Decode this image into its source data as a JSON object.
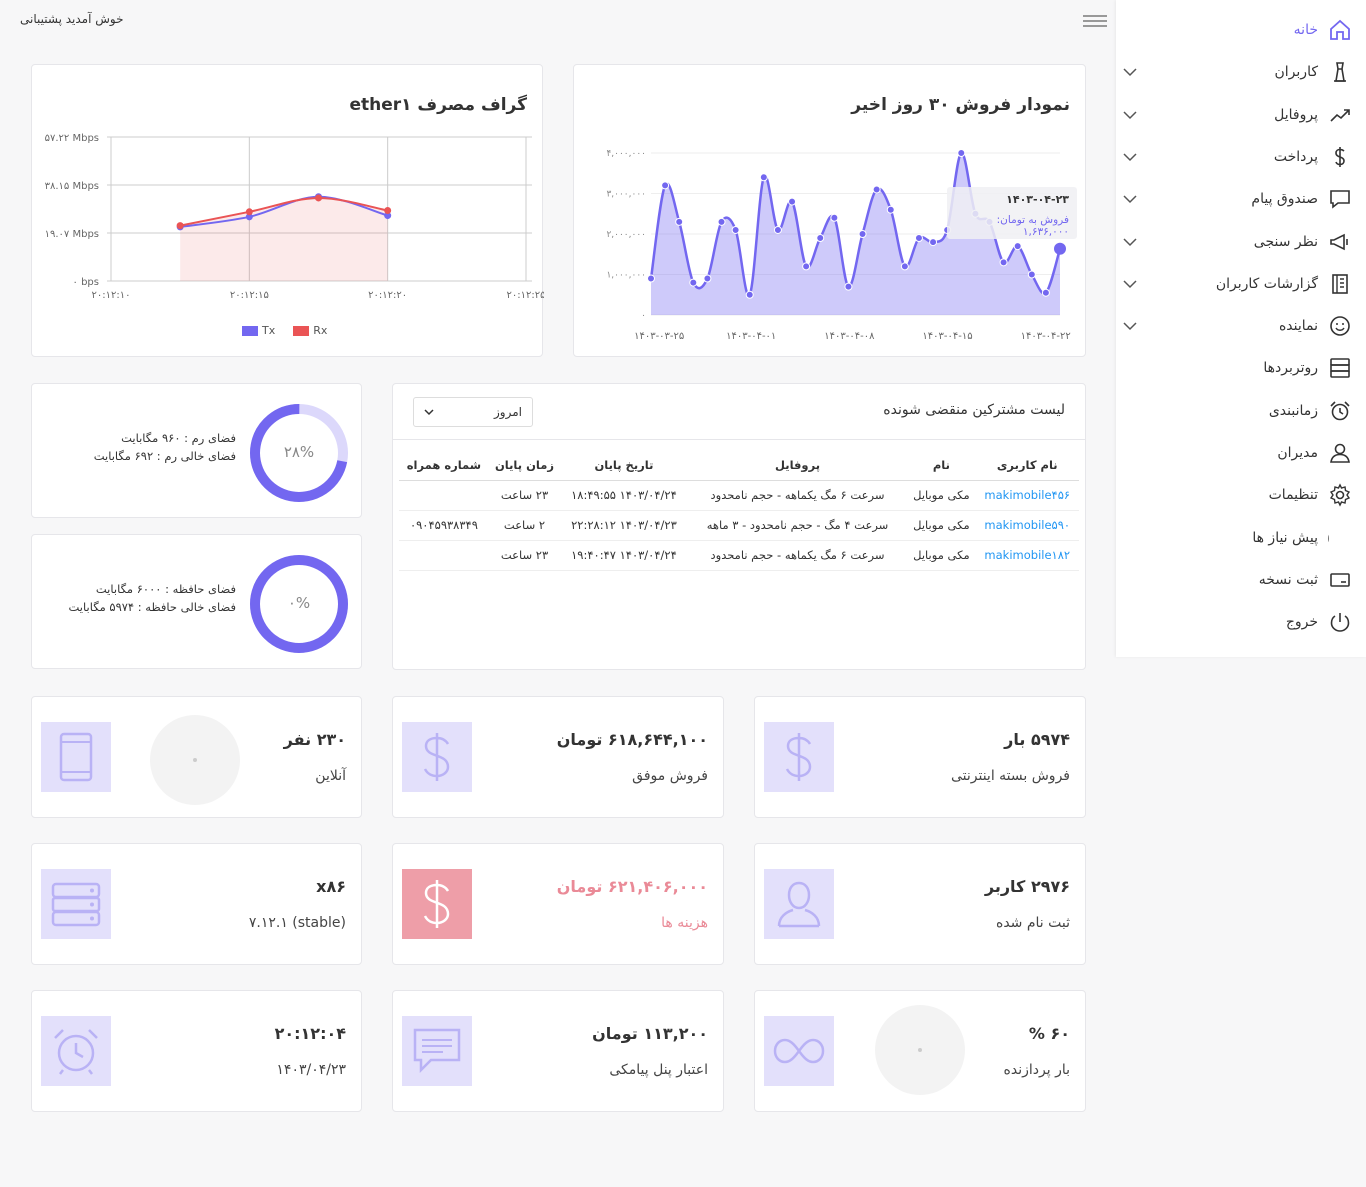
{
  "header": {
    "welcome": "خوش آمدید پشتیبانی"
  },
  "sidebar": {
    "items": [
      {
        "label": "خانه",
        "icon": "home-icon",
        "active": true
      },
      {
        "label": "کاربران",
        "icon": "user-tie-icon"
      },
      {
        "label": "پروفایل",
        "icon": "trend-icon"
      },
      {
        "label": "پرداخت",
        "icon": "dollar-icon"
      },
      {
        "label": "صندوق پیام",
        "icon": "message-icon"
      },
      {
        "label": "نظر سنجی",
        "icon": "megaphone-icon"
      },
      {
        "label": "گزارشات کاربران",
        "icon": "report-book-icon"
      },
      {
        "label": "نماینده",
        "icon": "smiley-icon"
      },
      {
        "label": "روتربردها",
        "icon": "server-icon"
      },
      {
        "label": "زمانبندی",
        "icon": "alarm-clock-icon"
      },
      {
        "label": "مدیران",
        "icon": "admin-user-icon"
      },
      {
        "label": "تنظیمات",
        "icon": "gear-icon"
      },
      {
        "label": "پیش نیاز ها",
        "icon": "quote-icon"
      },
      {
        "label": "ثبت نسخه",
        "icon": "card-icon"
      },
      {
        "label": "خروج",
        "icon": "power-icon"
      }
    ]
  },
  "traffic": {
    "title": "گراف مصرف ether۱",
    "legend": [
      "Tx",
      "Rx"
    ]
  },
  "sales": {
    "title": "نمودار فروش ۳۰ روز اخیر",
    "tooltip_date": "۱۴۰۳-۰۴-۲۳",
    "tooltip_value": "فروش به تومان: ۱,۶۳۶,۰۰۰"
  },
  "chart_data": [
    {
      "type": "line",
      "title": "گراف مصرف ether۱",
      "x": [
        "۲۰:۱۲:۱۰",
        "۲۰:۱۲:۱۵",
        "۲۰:۱۲:۲۰",
        "۲۰:۱۲:۲۵"
      ],
      "y_ticks": [
        "۰ bps",
        "۱۹.۰۷ Mbps",
        "۳۸.۱۵ Mbps",
        "۵۷.۲۲ Mbps"
      ],
      "ylim": [
        0,
        57.22
      ],
      "yunit": "Mbps",
      "series": [
        {
          "name": "Tx",
          "color": "#7367f0",
          "x_seconds": [
            12.5,
            15,
            17.5,
            20
          ],
          "values": [
            21.5,
            25.5,
            33.5,
            26.0
          ]
        },
        {
          "name": "Rx",
          "color": "#ea5455",
          "x_seconds": [
            12.5,
            15,
            17.5,
            20
          ],
          "values": [
            22.0,
            27.5,
            33.0,
            28.0
          ]
        }
      ],
      "legend": "bottom",
      "grid": true
    },
    {
      "type": "area",
      "title": "نمودار فروش ۳۰ روز اخیر",
      "x_ticks": [
        "۱۴۰۳-۰۳-۲۵",
        "۱۴۰۳-۰۴-۰۱",
        "۱۴۰۳-۰۴-۰۸",
        "۱۴۰۳-۰۴-۱۵",
        "۱۴۰۳-۰۴-۲۲"
      ],
      "y_ticks": [
        "۰",
        "۱,۰۰۰,۰۰۰",
        "۲,۰۰۰,۰۰۰",
        "۳,۰۰۰,۰۰۰",
        "۴,۰۰۰,۰۰۰"
      ],
      "ylim": [
        0,
        4000000
      ],
      "color": "#7367f0",
      "values": [
        900000,
        3200000,
        2300000,
        800000,
        900000,
        2300000,
        2100000,
        500000,
        3400000,
        2100000,
        2800000,
        1200000,
        1900000,
        2400000,
        700000,
        2000000,
        3100000,
        2600000,
        1200000,
        1900000,
        1800000,
        2100000,
        4000000,
        2500000,
        2300000,
        1300000,
        1700000,
        1000000,
        550000,
        1636000
      ],
      "grid": false
    }
  ],
  "resources": {
    "ram": {
      "percent_text": "۲۸%",
      "percent": 28,
      "line1": "فضای رم : ۹۶۰ مگابایت",
      "line2": "فضای خالی رم : ۶۹۲ مگابایت"
    },
    "storage": {
      "percent_text": "۰%",
      "percent": 0,
      "line1": "فضای حافظه : ۶۰۰۰ مگابایت",
      "line2": "فضای خالی حافظه : ۵۹۷۴ مگابایت"
    }
  },
  "expiring": {
    "title": "لیست مشترکین منقضی شونده",
    "filter": "امروز",
    "columns": [
      "نام کاربری",
      "نام",
      "پروفایل",
      "تاریخ پایان",
      "زمان پایان",
      "شماره همراه"
    ],
    "rows": [
      [
        "makimobile۴۵۶",
        "مکی موبایل",
        "سرعت ۶ مگ یکماهه - حجم نامحدود",
        "۱۴۰۳/۰۴/۲۴ ۱۸:۴۹:۵۵",
        "۲۳ ساعت",
        ""
      ],
      [
        "makimobile۵۹۰",
        "مکی موبایل",
        "سرعت ۴ مگ - حجم نامحدود - ۳ ماهه",
        "۱۴۰۳/۰۴/۲۳ ۲۲:۲۸:۱۲",
        "۲ ساعت",
        "۰۹۰۴۵۹۳۸۳۴۹"
      ],
      [
        "makimobile۱۸۲",
        "مکی موبایل",
        "سرعت ۶ مگ یکماهه - حجم نامحدود",
        "۱۴۰۳/۰۴/۲۴ ۱۹:۴۰:۴۷",
        "۲۳ ساعت",
        ""
      ]
    ]
  },
  "stats": {
    "package_sales": {
      "value": "۵۹۷۴ بار",
      "label": "فروش بسته اینترنتی"
    },
    "successful_sales": {
      "value": "۶۱۸,۶۴۴,۱۰۰ تومان",
      "label": "فروش موفق"
    },
    "online": {
      "value": "۲۳۰ نفر",
      "label": "آنلاین"
    },
    "registered": {
      "value": "۲۹۷۶ کاربر",
      "label": "ثبت نام شده"
    },
    "expenses": {
      "value": "۶۲۱,۴۰۶,۰۰۰ تومان",
      "label": "هزینه ها",
      "color": "#ea8a97"
    },
    "router": {
      "value": "x۸۶",
      "label": "(stable) ۷.۱۲.۱"
    },
    "cpu": {
      "value": "۶۰ %",
      "label": "بار پردازنده"
    },
    "sms_credit": {
      "value": "۱۱۳,۲۰۰ تومان",
      "label": "اعتبار پنل پیامکی"
    },
    "clock": {
      "value": "۲۰:۱۲:۰۴",
      "label": "۱۴۰۳/۰۴/۲۳"
    }
  }
}
